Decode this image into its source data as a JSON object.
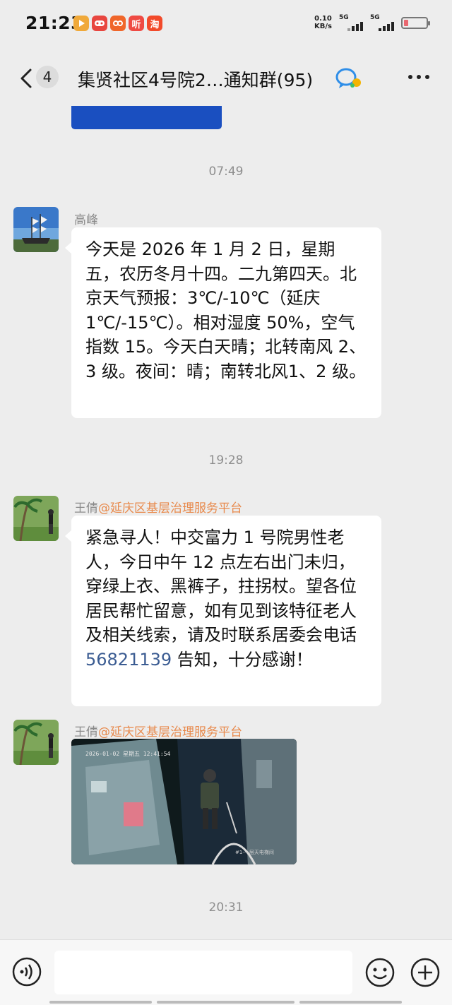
{
  "status_bar": {
    "time": "21:23",
    "net_speed": "0.10",
    "net_unit": "KB/s",
    "sim1": "5G",
    "sim2": "5G",
    "battery_level": 0.2,
    "app_icons": [
      "video-app-icon",
      "game-app-icon",
      "cloud-app-icon",
      "listen-app-icon",
      "taobao-app-icon"
    ],
    "app_icon_text": [
      "",
      "",
      "",
      "听",
      "淘"
    ]
  },
  "header": {
    "unread_count": "4",
    "title": "集贤社区4号院2…通知群(95)"
  },
  "messages": [
    {
      "timestamp": "07:49",
      "sender": "高峰",
      "text": "今天是 2026 年 1 月 2 日，星期五，农历冬月十四。二九第四天。北京天气预报：3℃/-10℃（延庆1℃/-15℃）。相对湿度 50%，空气指数 15。今天白天晴；北转南风 2、3 级。夜间：晴；南转北风1、2 级。"
    },
    {
      "timestamp": "19:28",
      "sender": "王倩",
      "sender_at": "@延庆区基层治理服务平台",
      "text_before": "紧急寻人！中交富力 1 号院男性老人，今日中午 12 点左右出门未归，穿绿上衣、黑裤子，拄拐杖。望各位居民帮忙留意，如有见到该特征老人及相关线索，请及时联系居委会电话 ",
      "phone": "56821139",
      "text_after": " 告知，十分感谢！"
    },
    {
      "sender": "王倩",
      "sender_at": "@延庆区基层治理服务平台",
      "video_caption": "2026-01-02 星期五 12:41:54",
      "video_label": "#1-一层天电梯间"
    }
  ],
  "last_timestamp": "20:31",
  "colors": {
    "background": "#ededed",
    "bubble": "#ffffff",
    "mention": "#e8894b",
    "phone_link": "#3b5c92",
    "banner_blue": "#1a4fc0"
  }
}
